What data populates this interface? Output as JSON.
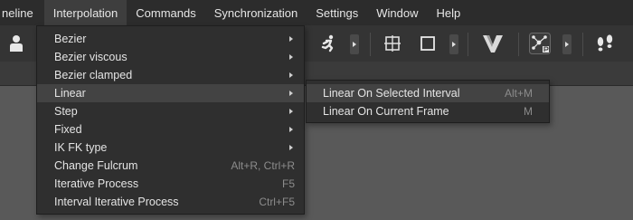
{
  "menubar": {
    "items": [
      {
        "label": "neline"
      },
      {
        "label": "Interpolation"
      },
      {
        "label": "Commands"
      },
      {
        "label": "Synchronization"
      },
      {
        "label": "Settings"
      },
      {
        "label": "Window"
      },
      {
        "label": "Help"
      }
    ],
    "active": "Interpolation"
  },
  "toolbar": {
    "icons": [
      "user-icon",
      "running-figure-icon",
      "crosshair-box-icon",
      "square-icon",
      "v-logo-icon",
      "pivot-node-icon",
      "footsteps-icon"
    ]
  },
  "interpolation_menu": {
    "items": [
      {
        "label": "Bezier",
        "shortcut": "",
        "submenu": true
      },
      {
        "label": "Bezier viscous",
        "shortcut": "",
        "submenu": true
      },
      {
        "label": "Bezier clamped",
        "shortcut": "",
        "submenu": true
      },
      {
        "label": "Linear",
        "shortcut": "",
        "submenu": true,
        "highlighted": true
      },
      {
        "label": "Step",
        "shortcut": "",
        "submenu": true
      },
      {
        "label": "Fixed",
        "shortcut": "",
        "submenu": true
      },
      {
        "label": "IK FK type",
        "shortcut": "",
        "submenu": true
      },
      {
        "label": "Change Fulcrum",
        "shortcut": "Alt+R, Ctrl+R",
        "submenu": false
      },
      {
        "label": "Iterative Process",
        "shortcut": "F5",
        "submenu": false
      },
      {
        "label": "Interval Iterative Process",
        "shortcut": "Ctrl+F5",
        "submenu": false
      }
    ]
  },
  "linear_submenu": {
    "items": [
      {
        "label": "Linear On Selected Interval",
        "shortcut": "Alt+M",
        "highlighted": true
      },
      {
        "label": "Linear On Current Frame",
        "shortcut": "M"
      }
    ]
  },
  "colors": {
    "menubar_bg": "#2c2c2c",
    "menu_bg": "#2f2f2f",
    "highlight_bg": "#434343",
    "workspace_bg": "#595959"
  }
}
